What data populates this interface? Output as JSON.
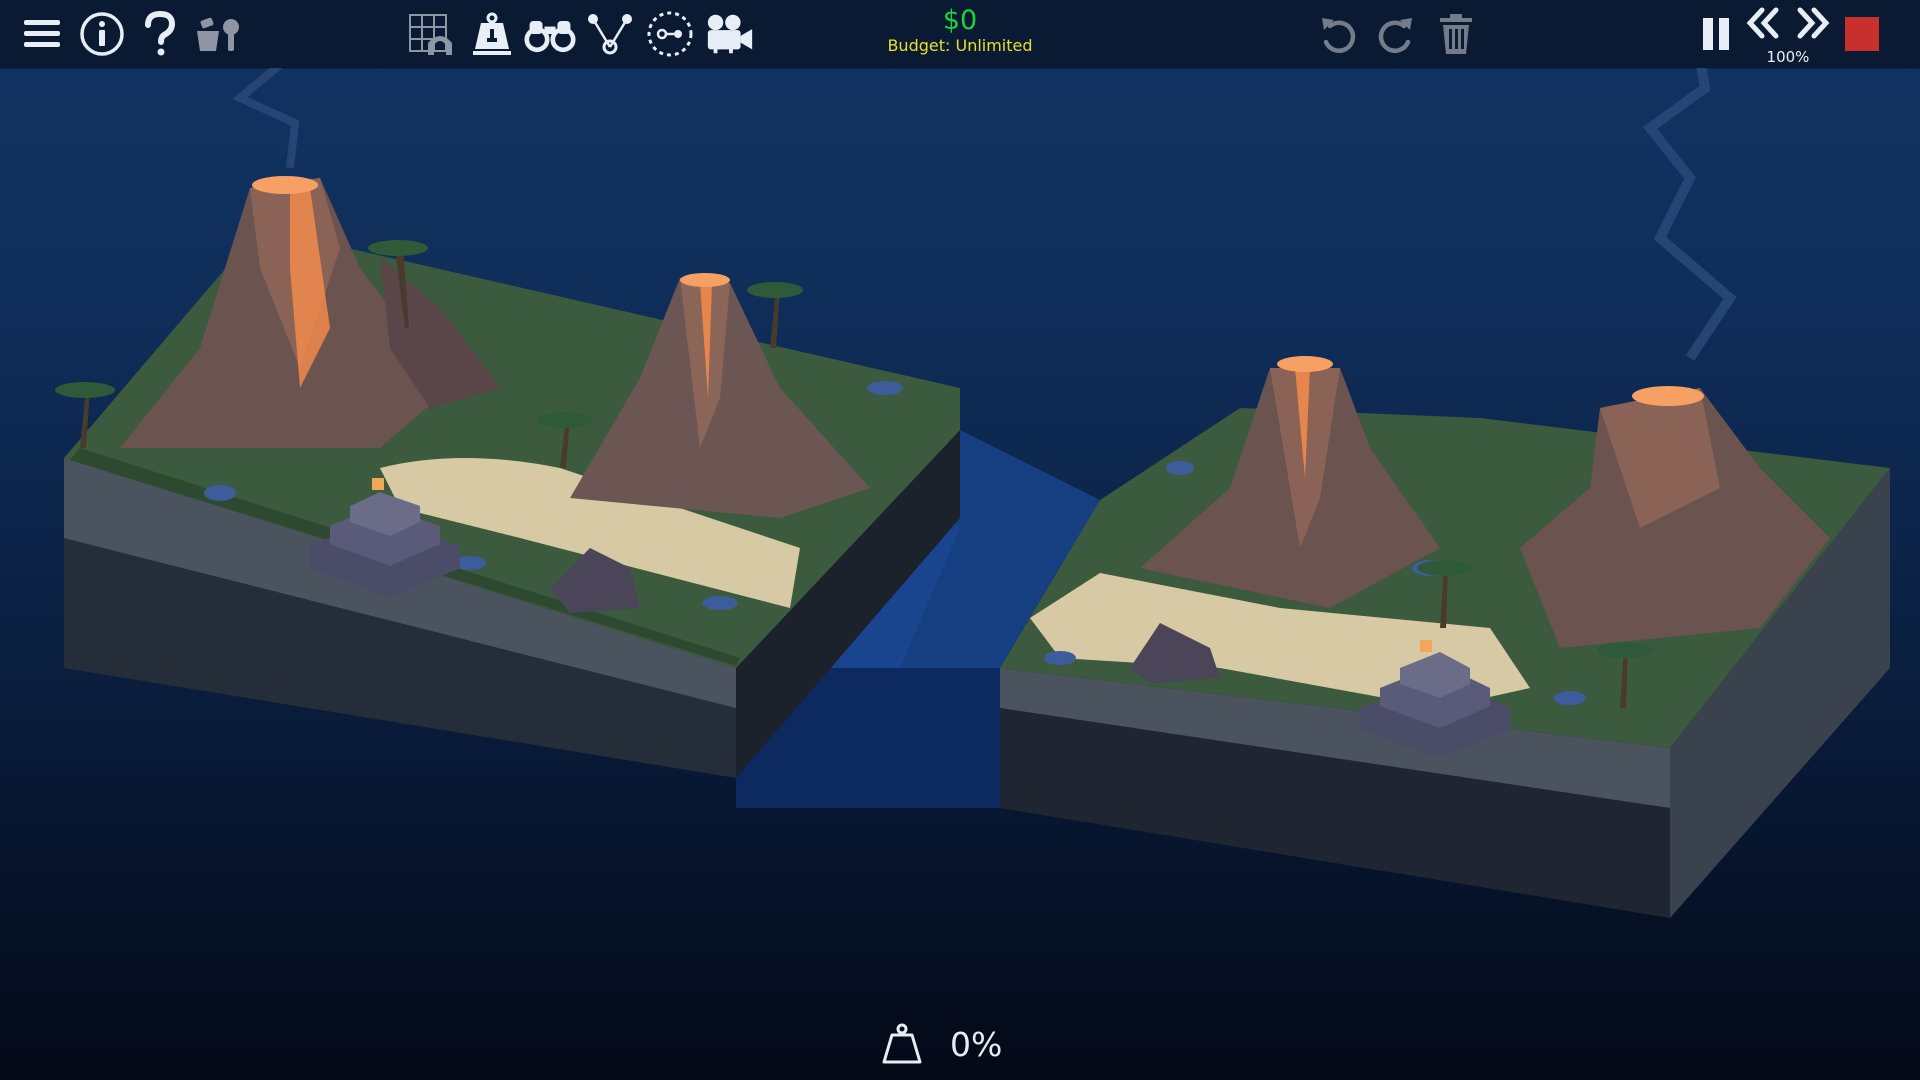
{
  "toolbar": {
    "left_tools": [
      {
        "name": "menu-icon"
      },
      {
        "name": "info-icon"
      },
      {
        "name": "help-icon"
      },
      {
        "name": "mod-tools-icon"
      }
    ],
    "center_tools": [
      {
        "name": "grid-arch-icon"
      },
      {
        "name": "weight-icon"
      },
      {
        "name": "binoculars-icon"
      },
      {
        "name": "split-joint-icon"
      },
      {
        "name": "camera-path-icon"
      },
      {
        "name": "video-camera-icon"
      }
    ],
    "edit_tools": [
      {
        "name": "undo-icon"
      },
      {
        "name": "redo-icon"
      },
      {
        "name": "trash-icon"
      }
    ],
    "playback": [
      {
        "name": "pause-icon"
      },
      {
        "name": "slow-down-icon"
      },
      {
        "name": "speed-up-icon"
      },
      {
        "name": "stop-icon"
      }
    ]
  },
  "budget": {
    "cost": "$0",
    "label": "Budget: Unlimited"
  },
  "sim_speed": "100%",
  "stress": {
    "icon": "weight-bag-icon",
    "value": "0%"
  },
  "colors": {
    "money": "#19d43a",
    "budget": "#e6e02c",
    "stop": "#c8302e",
    "lava": "#f08a4b",
    "water": "#163f82"
  },
  "scene": {
    "left_island": "volcano-island-left",
    "water_gap": "water-channel",
    "right_island": "volcano-island-right"
  }
}
